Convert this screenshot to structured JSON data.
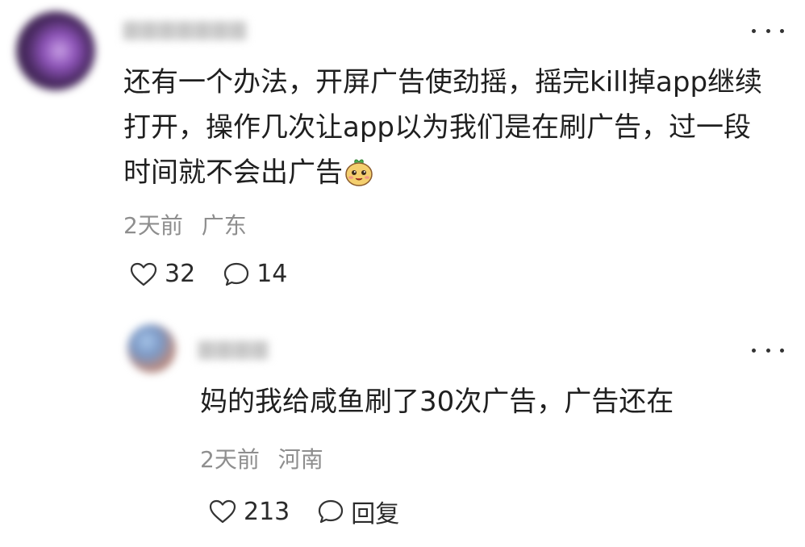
{
  "comments": [
    {
      "text": "还有一个办法，开屏广告使劲摇，摇完kill掉app继续打开，操作几次让app以为我们是在刷广告，过一段时间就不会出广告",
      "emoji_icon": "smiling-face-emoji",
      "time": "2天前",
      "location": "广东",
      "likes": "32",
      "replies": "14",
      "more_icon": "more-dots-icon"
    },
    {
      "text": "妈的我给咸鱼刷了30次广告，广告还在",
      "time": "2天前",
      "location": "河南",
      "likes": "213",
      "reply_label": "回复",
      "more_icon": "more-dots-icon"
    }
  ],
  "icons": {
    "like": "heart-outline-icon",
    "comment": "speech-bubble-icon"
  },
  "colors": {
    "text": "#1f1f1f",
    "meta": "#8e8e8e",
    "background": "#ffffff"
  }
}
